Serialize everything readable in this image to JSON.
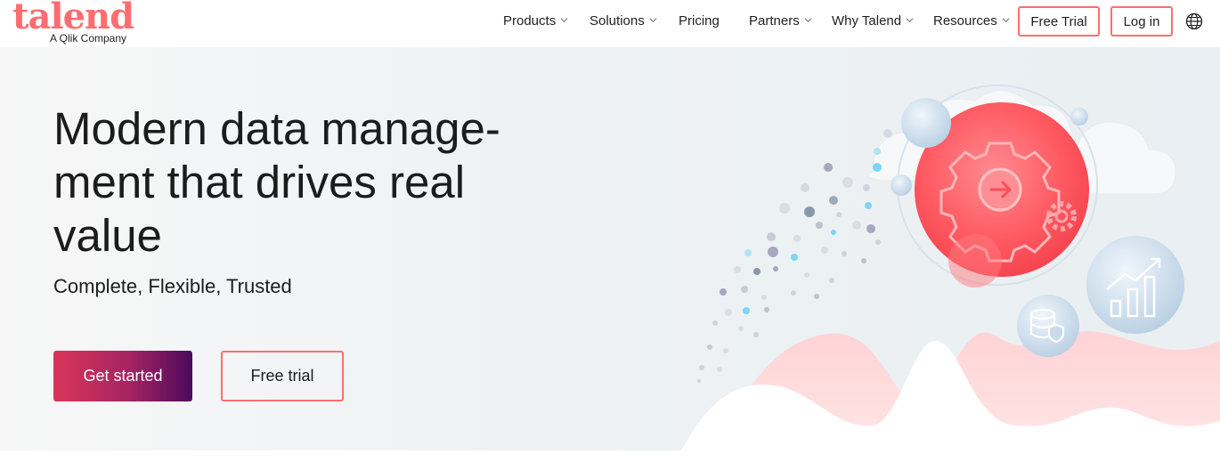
{
  "brand": {
    "name": "talend",
    "tagline": "A Qlik Company",
    "color": "#ff6d70"
  },
  "nav": {
    "items": [
      {
        "label": "Products",
        "has_dropdown": true
      },
      {
        "label": "Solutions",
        "has_dropdown": true
      },
      {
        "label": "Pricing",
        "has_dropdown": false
      },
      {
        "label": "Partners",
        "has_dropdown": true
      },
      {
        "label": "Why Talend",
        "has_dropdown": true
      },
      {
        "label": "Resources",
        "has_dropdown": true
      }
    ],
    "free_trial_label": "Free Trial",
    "login_label": "Log in",
    "language_icon": "globe-icon"
  },
  "hero": {
    "title": "Modern data manage-ment that drives real value",
    "subtitle": "Complete, Flexible, Trusted",
    "primary_cta": "Get started",
    "secondary_cta": "Free trial",
    "illustration_icons": [
      "gear-icon",
      "arrow-right-icon",
      "database-shield-icon",
      "bar-chart-icon"
    ]
  },
  "colors": {
    "accent": "#ff6d70",
    "cta_gradient_start": "#d9355a",
    "cta_gradient_end": "#4a0a5c",
    "hero_background": "#eef2f4"
  }
}
